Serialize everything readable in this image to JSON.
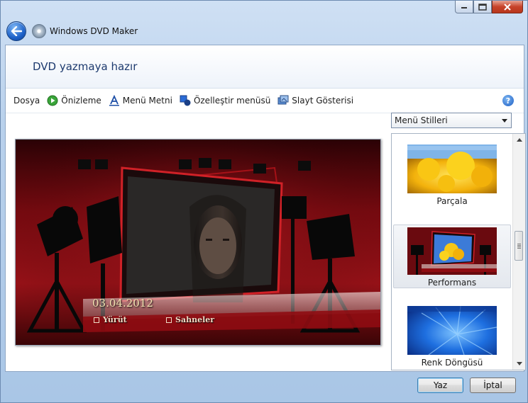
{
  "window": {
    "title": "Windows DVD Maker"
  },
  "header": {
    "title": "DVD yazmaya hazır"
  },
  "toolbar": {
    "items": [
      {
        "label": "Dosya"
      },
      {
        "label": "Önizleme"
      },
      {
        "label": "Menü Metni"
      },
      {
        "label": "Özelleştir menüsü"
      },
      {
        "label": "Slayt Gösterisi"
      }
    ],
    "help": "?"
  },
  "preview": {
    "date": "03.04.2012",
    "play_label": "Yürüt",
    "scenes_label": "Sahneler"
  },
  "styles": {
    "dropdown_value": "Menü Stilleri",
    "items": [
      {
        "label": "Parçala"
      },
      {
        "label": "Performans"
      },
      {
        "label": "Renk Döngüsü"
      }
    ],
    "selected": "Performans"
  },
  "footer": {
    "write_label": "Yaz",
    "cancel_label": "İptal"
  },
  "colors": {
    "accent": "#1d3a6e",
    "preview_red": "#8b0d14"
  }
}
